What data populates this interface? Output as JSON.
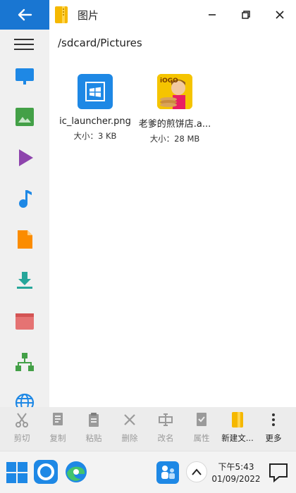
{
  "window": {
    "title": "图片"
  },
  "path": "/sdcard/Pictures",
  "files": [
    {
      "name": "ic_launcher.png",
      "size": "大小：3 KB"
    },
    {
      "name": "老爹的煎饼店.a...",
      "size": "大小：28 MB"
    }
  ],
  "sidebar": {
    "items": [
      {
        "icon": "desktop-icon",
        "color": "#1e88e5"
      },
      {
        "icon": "image-icon",
        "color": "#43a047"
      },
      {
        "icon": "play-icon",
        "color": "#8e44ad"
      },
      {
        "icon": "music-icon",
        "color": "#1e88e5"
      },
      {
        "icon": "document-icon",
        "color": "#fb8c00"
      },
      {
        "icon": "download-icon",
        "color": "#26a69a"
      },
      {
        "icon": "app-window-icon",
        "color": "#e57373"
      },
      {
        "icon": "network-icon",
        "color": "#43a047"
      },
      {
        "icon": "globe-icon",
        "color": "#1e88e5"
      }
    ]
  },
  "toolbar": {
    "cut": "剪切",
    "copy": "复制",
    "paste": "粘贴",
    "delete": "删除",
    "rename": "改名",
    "properties": "属性",
    "new_folder": "新建文...",
    "more": "更多"
  },
  "taskbar": {
    "time": "下午5:43",
    "date": "01/09/2022"
  },
  "colors": {
    "accent": "#1976d2",
    "sidebar_bg": "#f0f0f0",
    "toolbar_bg": "#ececec",
    "disabled_text": "#9a9a9a"
  }
}
